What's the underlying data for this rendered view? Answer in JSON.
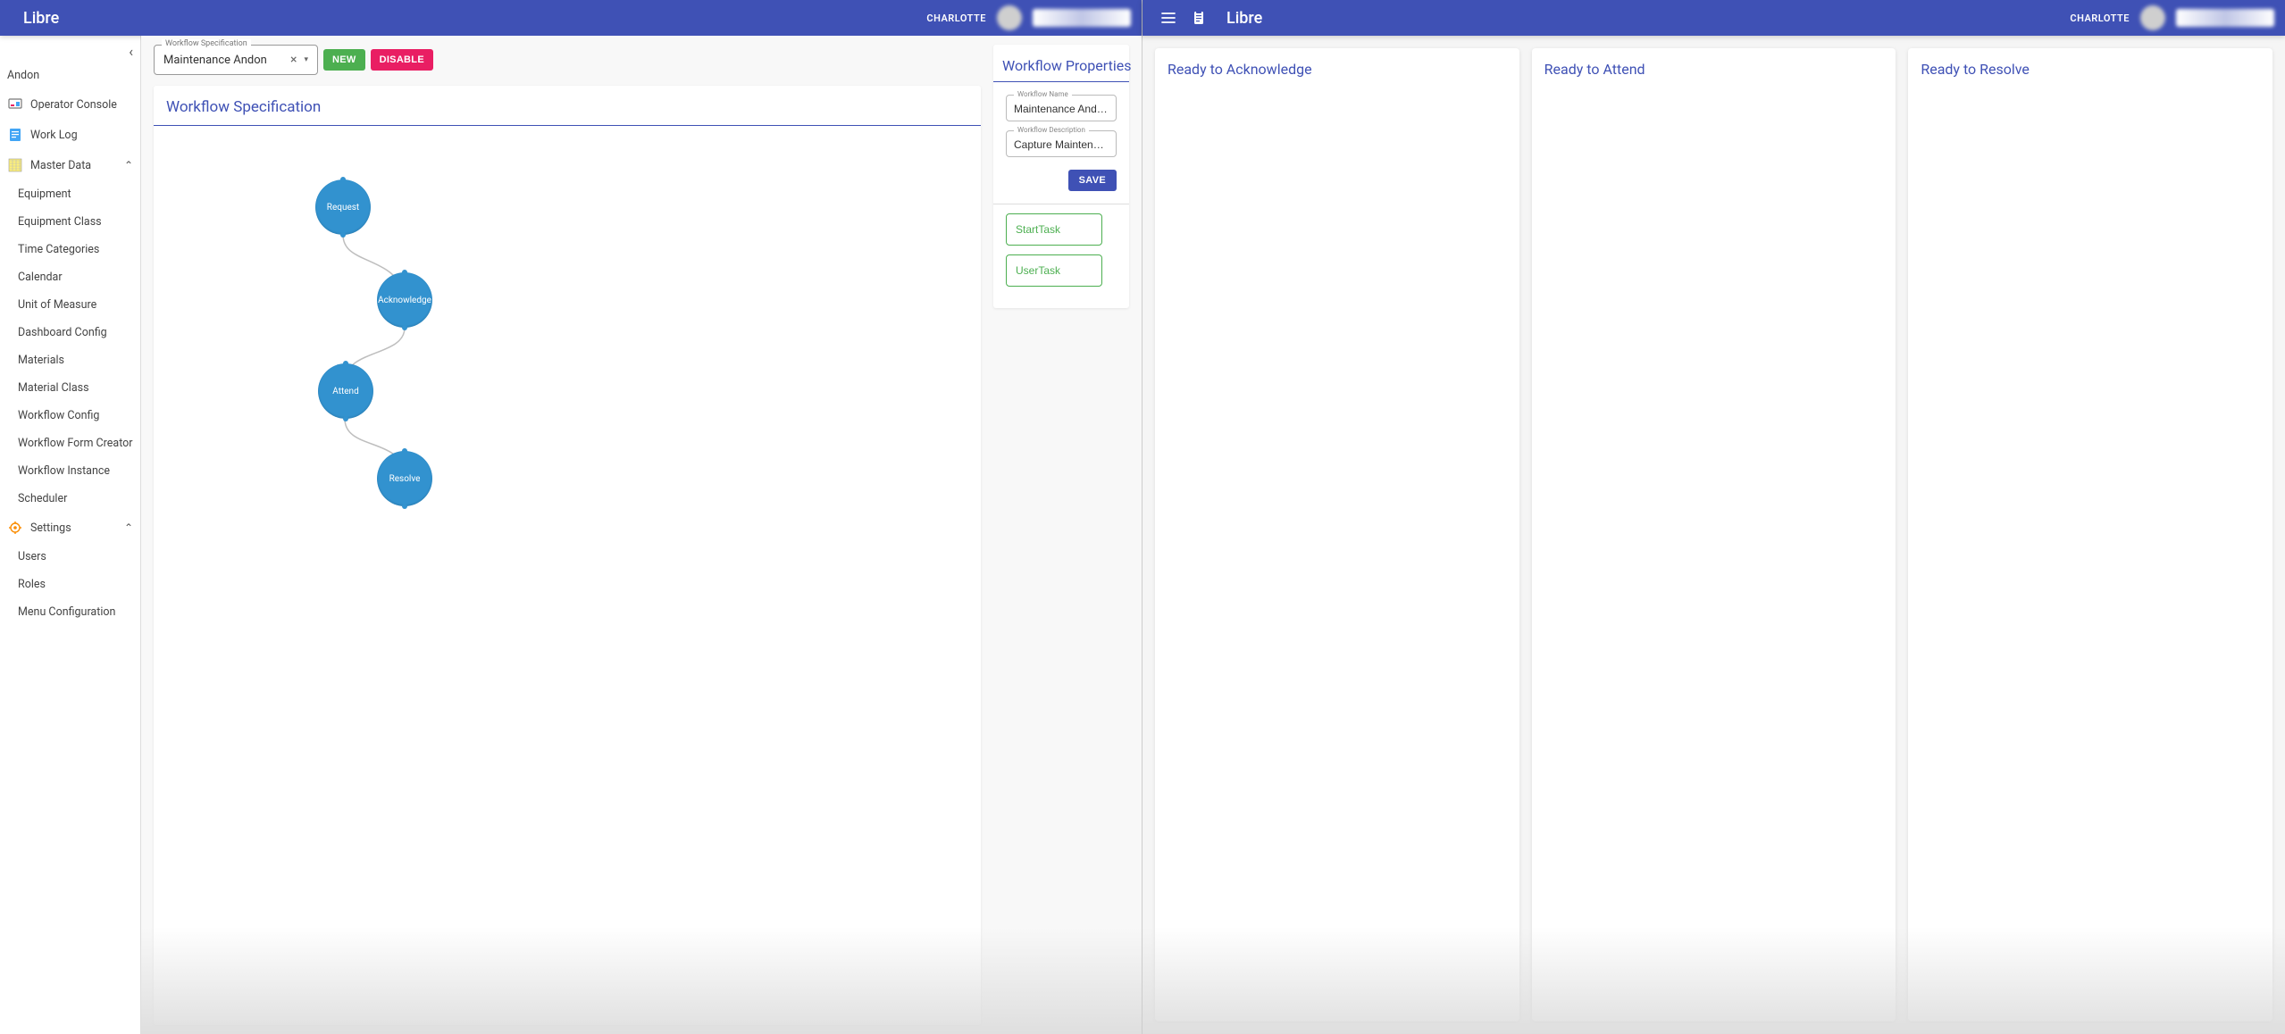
{
  "left": {
    "header": {
      "title": "Libre",
      "user": "CHARLOTTE"
    },
    "sidebar": {
      "items": [
        {
          "label": "Andon",
          "icon": ""
        },
        {
          "label": "Operator Console",
          "icon": "console"
        },
        {
          "label": "Work Log",
          "icon": "log"
        },
        {
          "label": "Master Data",
          "icon": "md",
          "expandable": true,
          "open": true,
          "children": [
            "Equipment",
            "Equipment Class",
            "Time Categories",
            "Calendar",
            "Unit of Measure",
            "Dashboard Config",
            "Materials",
            "Material Class",
            "Workflow Config",
            "Workflow Form Creator",
            "Workflow Instance",
            "Scheduler"
          ]
        },
        {
          "label": "Settings",
          "icon": "gear",
          "expandable": true,
          "open": true,
          "children": [
            "Users",
            "Roles",
            "Menu Configuration"
          ]
        }
      ]
    },
    "specSelect": {
      "label": "Workflow Specification",
      "value": "Maintenance Andon"
    },
    "actions": {
      "new": "NEW",
      "disable": "DISABLE"
    },
    "section": {
      "spec_title": "Workflow Specification",
      "props_title": "Workflow Properties"
    },
    "diagram": {
      "nodes": [
        "Request",
        "Acknowledge",
        "Attend",
        "Resolve"
      ]
    },
    "properties": {
      "name_label": "Workflow Name",
      "name_value": "Maintenance Andon",
      "desc_label": "Workflow Description",
      "desc_value": "Capture Maintenanc",
      "save": "SAVE",
      "tasks": [
        "StartTask",
        "UserTask"
      ]
    }
  },
  "right": {
    "header": {
      "title": "Libre",
      "user": "CHARLOTTE"
    },
    "columns": [
      "Ready to Acknowledge",
      "Ready to Attend",
      "Ready to Resolve"
    ]
  }
}
